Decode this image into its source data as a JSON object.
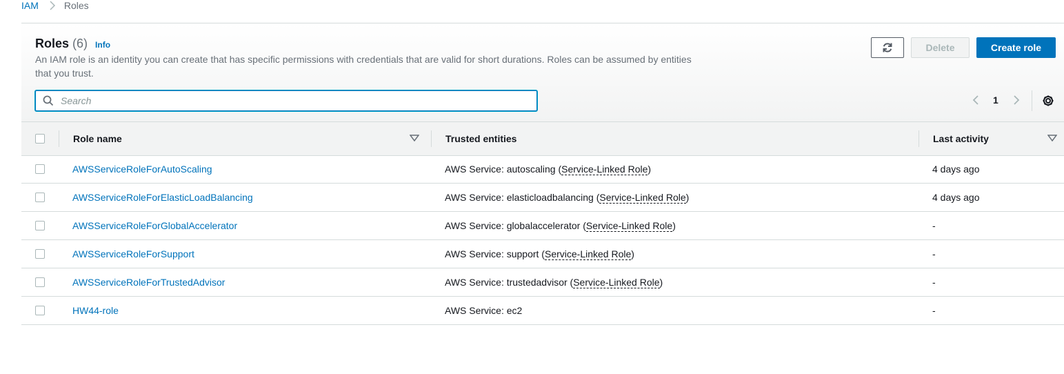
{
  "breadcrumb": {
    "items": [
      "IAM",
      "Roles"
    ]
  },
  "header": {
    "title": "Roles",
    "count": "(6)",
    "info": "Info",
    "description": "An IAM role is an identity you can create that has specific permissions with credentials that are valid for short durations. Roles can be assumed by entities that you trust."
  },
  "toolbar": {
    "refresh_icon": "refresh-icon",
    "delete_label": "Delete",
    "create_label": "Create role"
  },
  "search": {
    "placeholder": "Search",
    "value": ""
  },
  "pagination": {
    "current_page": "1"
  },
  "table": {
    "columns": [
      "Role name",
      "Trusted entities",
      "Last activity"
    ],
    "rows": [
      {
        "name": "AWSServiceRoleForAutoScaling",
        "entity_prefix": "AWS Service: autoscaling (",
        "entity_link": "Service-Linked Role",
        "entity_suffix": ")",
        "activity": "4 days ago"
      },
      {
        "name": "AWSServiceRoleForElasticLoadBalancing",
        "entity_prefix": "AWS Service: elasticloadbalancing (",
        "entity_link": "Service-Linked Role",
        "entity_suffix": ")",
        "activity": "4 days ago"
      },
      {
        "name": "AWSServiceRoleForGlobalAccelerator",
        "entity_prefix": "AWS Service: globalaccelerator (",
        "entity_link": "Service-Linked Role",
        "entity_suffix": ")",
        "activity": "-"
      },
      {
        "name": "AWSServiceRoleForSupport",
        "entity_prefix": "AWS Service: support (",
        "entity_link": "Service-Linked Role",
        "entity_suffix": ")",
        "activity": "-"
      },
      {
        "name": "AWSServiceRoleForTrustedAdvisor",
        "entity_prefix": "AWS Service: trustedadvisor (",
        "entity_link": "Service-Linked Role",
        "entity_suffix": ")",
        "activity": "-"
      },
      {
        "name": "HW44-role",
        "entity_prefix": "AWS Service: ec2",
        "entity_link": "",
        "entity_suffix": "",
        "activity": "-"
      }
    ]
  },
  "colors": {
    "link": "#0073bb",
    "primary_button": "#0073bb",
    "muted_text": "#687078",
    "border": "#d5dbdb"
  }
}
